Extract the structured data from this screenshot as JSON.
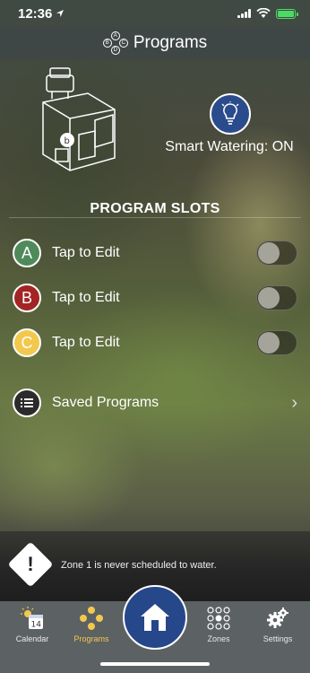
{
  "status_bar": {
    "time": "12:36"
  },
  "header": {
    "title": "Programs",
    "icon": "abc-programs-icon"
  },
  "smart_watering": {
    "label": "Smart Watering: ON",
    "icon": "lightbulb-icon"
  },
  "program_slots": {
    "title": "PROGRAM SLOTS",
    "slots": [
      {
        "letter": "A",
        "label": "Tap to Edit",
        "color": "#4f8a5b",
        "enabled": false
      },
      {
        "letter": "B",
        "label": "Tap to Edit",
        "color": "#a32424",
        "enabled": false
      },
      {
        "letter": "C",
        "label": "Tap to Edit",
        "color": "#f2c94c",
        "enabled": false
      }
    ]
  },
  "saved_programs": {
    "label": "Saved Programs",
    "icon": "list-icon"
  },
  "alert": {
    "text": "Zone 1 is never scheduled to water.",
    "icon": "warning-icon"
  },
  "tab_bar": {
    "tabs": [
      {
        "label": "Calendar",
        "icon": "calendar-icon",
        "day": "14"
      },
      {
        "label": "Programs",
        "icon": "abc-programs-icon",
        "active": true
      },
      {
        "label": "Zones",
        "icon": "zones-grid-icon"
      },
      {
        "label": "Settings",
        "icon": "gears-icon"
      }
    ],
    "home_icon": "home-icon"
  },
  "colors": {
    "accent": "#26478a",
    "active_tab": "#f2c94c"
  }
}
